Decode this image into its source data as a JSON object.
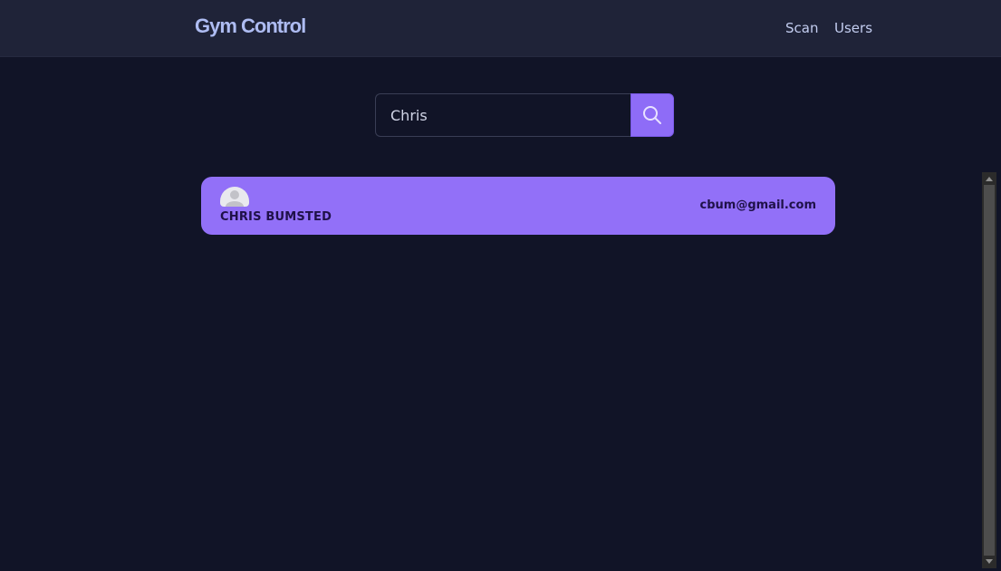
{
  "navbar": {
    "brand": "Gym Control",
    "links": [
      {
        "label": "Scan"
      },
      {
        "label": "Users"
      }
    ]
  },
  "search": {
    "value": "Chris",
    "button_icon": "search-icon"
  },
  "results": [
    {
      "name": "CHRIS BUMSTED",
      "email": "cbum@gmail.com",
      "avatar_icon": "user-avatar-icon"
    }
  ],
  "colors": {
    "background": "#111427",
    "navbar": "#1f2338",
    "accent": "#9270f8",
    "brand": "#aebcf2"
  }
}
